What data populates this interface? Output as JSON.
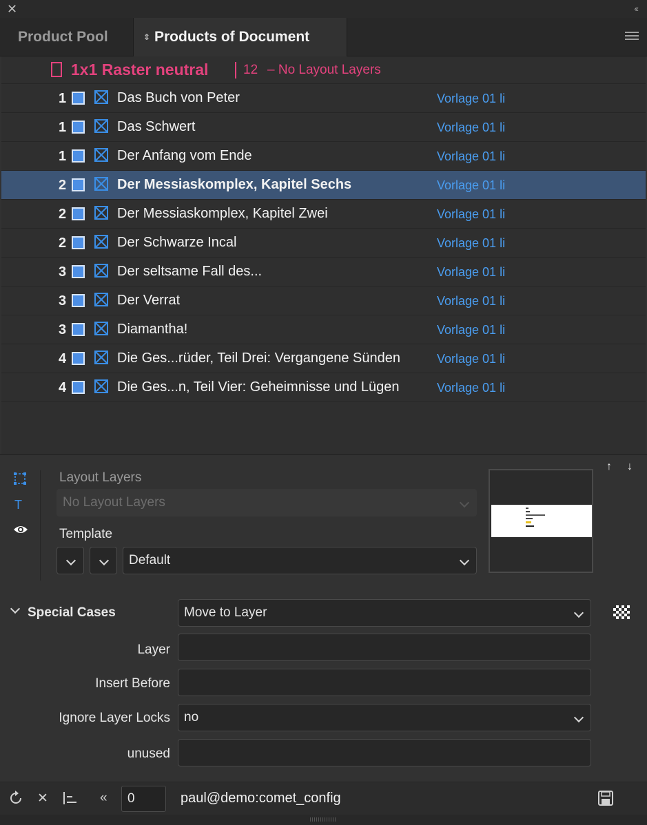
{
  "window": {
    "close_glyph": "✕",
    "collapse_glyph": "‹‹"
  },
  "tabs": [
    {
      "label": "Product Pool",
      "active": false
    },
    {
      "label": "Products of Document",
      "active": true
    }
  ],
  "group": {
    "name": "1x1 Raster neutral",
    "count": "12",
    "note": "– No Layout Layers",
    "color": "#e3427d"
  },
  "products": [
    {
      "num": "1",
      "name": "Das Buch von Peter",
      "template": "Vorlage 01 li",
      "selected": false
    },
    {
      "num": "1",
      "name": "Das Schwert",
      "template": "Vorlage 01 li",
      "selected": false
    },
    {
      "num": "1",
      "name": "Der Anfang vom Ende",
      "template": "Vorlage 01 li",
      "selected": false
    },
    {
      "num": "2",
      "name": "Der Messiaskomplex,  Kapitel Sechs",
      "template": "Vorlage 01 li",
      "selected": true
    },
    {
      "num": "2",
      "name": "Der Messiaskomplex,  Kapitel Zwei",
      "template": "Vorlage 01 li",
      "selected": false
    },
    {
      "num": "2",
      "name": "Der Schwarze Incal",
      "template": "Vorlage 01 li",
      "selected": false
    },
    {
      "num": "3",
      "name": "Der seltsame Fall des...",
      "template": "Vorlage 01 li",
      "selected": false
    },
    {
      "num": "3",
      "name": "Der Verrat",
      "template": "Vorlage 01 li",
      "selected": false
    },
    {
      "num": "3",
      "name": "Diamantha!",
      "template": "Vorlage 01 li",
      "selected": false
    },
    {
      "num": "4",
      "name": "Die Ges...rüder,  Teil Drei: Vergangene Sünden",
      "template": "Vorlage 01 li",
      "selected": false
    },
    {
      "num": "4",
      "name": "Die Ges...n,  Teil Vier: Geheimnisse und Lügen",
      "template": "Vorlage 01 li",
      "selected": false
    }
  ],
  "properties": {
    "layout_layers_label": "Layout Layers",
    "layout_layers_value": "No Layout Layers",
    "template_label": "Template",
    "template_value": "Default"
  },
  "special_cases": {
    "label": "Special Cases",
    "action": "Move to Layer",
    "layer_label": "Layer",
    "layer_value": "",
    "insert_before_label": "Insert Before",
    "insert_before_value": "",
    "ignore_locks_label": "Ignore Layer Locks",
    "ignore_locks_value": "no",
    "unused_label": "unused",
    "unused_value": ""
  },
  "bottom_bar": {
    "counter": "0",
    "config": "paul@demo:comet_config"
  },
  "colors": {
    "accent_blue": "#4a9df0",
    "selection": "#3c5576",
    "group_pink": "#e3427d"
  }
}
